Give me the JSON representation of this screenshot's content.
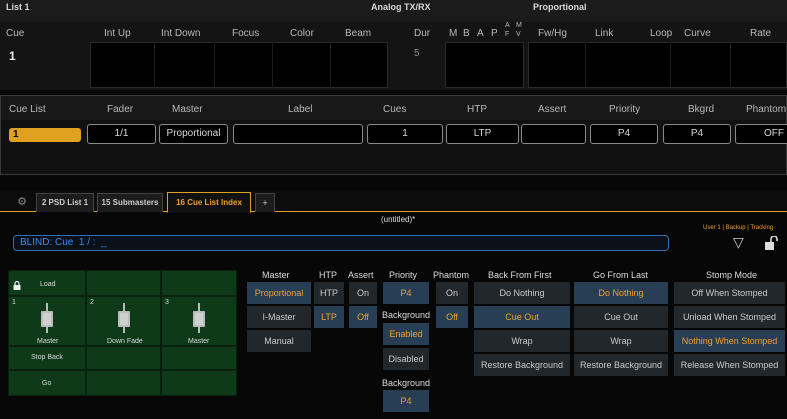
{
  "top_panel": {
    "title": "List 1",
    "group_labels": {
      "analog": "Analog TX/RX",
      "proportional": "Proportional"
    },
    "columns": [
      "Cue",
      "Int Up",
      "Int Down",
      "Focus",
      "Color",
      "Beam",
      "Dur",
      "M",
      "B",
      "A",
      "P",
      "A",
      "F",
      "M",
      "V",
      "Fw/Hg",
      "Link",
      "Loop",
      "Curve",
      "Rate"
    ],
    "cue_value": "1",
    "dur_value": "5"
  },
  "cue_list_panel": {
    "columns": [
      "Cue List",
      "Fader",
      "Master",
      "Label",
      "Cues",
      "HTP",
      "Assert",
      "Priority",
      "Bkgrd",
      "Phantom"
    ],
    "row": {
      "cue_list": "1",
      "fader": "1/1",
      "master": "Proportional",
      "label": "",
      "cues": "1",
      "htp": "LTP",
      "assert": "",
      "priority": "P4",
      "bkgrd": "P4",
      "phantom": "OFF"
    }
  },
  "tabs": [
    {
      "label": "2 PSD List 1",
      "active": false
    },
    {
      "label": "15 Submasters",
      "active": false
    },
    {
      "label": "16 Cue List Index",
      "active": true
    },
    {
      "label": "+",
      "active": false
    }
  ],
  "show_title": "(untitled)*",
  "status_text": "User 1 | Backup | Tracking",
  "command_line": "BLIND: Cue  1 / :  _",
  "faders": {
    "load_label": "Load",
    "numbers": [
      "1",
      "2",
      "3"
    ],
    "labels": [
      "Master",
      "Down Fade",
      "Master"
    ],
    "stop_back_label": "Stop Back",
    "go_label": "Go"
  },
  "options": {
    "master": {
      "header": "Master",
      "items": [
        "Proportional",
        "I-Master",
        "Manual"
      ],
      "selected": 0
    },
    "htp": {
      "header": "HTP",
      "items": [
        "HTP",
        "LTP"
      ],
      "selected": 1
    },
    "assert": {
      "header": "Assert",
      "items": [
        "On",
        "Off"
      ],
      "selected": 1
    },
    "priority": {
      "header": "Priority",
      "value": "P4"
    },
    "background_toggle": {
      "header": "Background",
      "items": [
        "Enabled",
        "Disabled"
      ],
      "selected": 0
    },
    "background": {
      "header": "Background",
      "value": "P4"
    },
    "phantom": {
      "header": "Phantom",
      "items": [
        "On",
        "Off"
      ],
      "selected": 1
    },
    "back_from_first": {
      "header": "Back From First",
      "items": [
        "Do Nothing",
        "Cue Out",
        "Wrap",
        "Restore Background"
      ],
      "selected": 1
    },
    "go_from_last": {
      "header": "Go From Last",
      "items": [
        "Do Nothing",
        "Cue Out",
        "Wrap",
        "Restore Background"
      ],
      "selected": 0
    },
    "stomp_mode": {
      "header": "Stomp Mode",
      "items": [
        "Off When Stomped",
        "Unload When Stomped",
        "Nothing When Stomped",
        "Release When Stomped"
      ],
      "selected": 2
    }
  },
  "colors": {
    "accent": "#f0a030",
    "selected_bg": "#283e55",
    "button_bg": "#22272c",
    "fader_green": "#0f3a1a",
    "command_blue": "#3a8ee8"
  }
}
